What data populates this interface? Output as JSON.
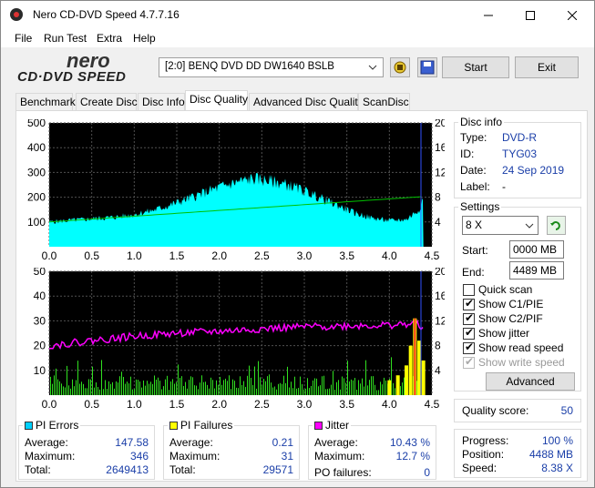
{
  "window": {
    "title": "Nero CD-DVD Speed 4.7.7.16"
  },
  "menu": [
    "File",
    "Run Test",
    "Extra",
    "Help"
  ],
  "logo": {
    "line1": "nero",
    "line2": "CD·DVD SPEED"
  },
  "toolbar": {
    "drive": "[2:0]   BENQ DVD DD DW1640 BSLB",
    "start_label": "Start",
    "exit_label": "Exit"
  },
  "tabs": [
    "Benchmark",
    "Create Disc",
    "Disc Info",
    "Disc Quality",
    "Advanced Disc Quality",
    "ScanDisc"
  ],
  "active_tab": "Disc Quality",
  "disc_info": {
    "heading": "Disc info",
    "type_label": "Type:",
    "type": "DVD-R",
    "id_label": "ID:",
    "id": "TYG03",
    "date_label": "Date:",
    "date": "24 Sep 2019",
    "label_label": "Label:",
    "label": "-"
  },
  "settings": {
    "heading": "Settings",
    "speed": "8 X",
    "start_label": "Start:",
    "start": "0000 MB",
    "end_label": "End:",
    "end": "4489 MB",
    "quick_scan": "Quick scan",
    "show_c1": "Show C1/PIE",
    "show_c2": "Show C2/PIF",
    "show_jitter": "Show jitter",
    "show_read": "Show read speed",
    "show_write": "Show write speed",
    "advanced": "Advanced"
  },
  "checks": {
    "quick_scan": false,
    "show_c1": true,
    "show_c2": true,
    "show_jitter": true,
    "show_read": true,
    "show_write": true
  },
  "quality": {
    "label": "Quality score:",
    "value": "50"
  },
  "progress": {
    "progress_label": "Progress:",
    "progress": "100 %",
    "position_label": "Position:",
    "position": "4488 MB",
    "speed_label": "Speed:",
    "speed": "8.38 X"
  },
  "pi_errors": {
    "heading": "PI Errors",
    "color": "#00d0ff",
    "avg_label": "Average:",
    "avg": "147.58",
    "max_label": "Maximum:",
    "max": "346",
    "total_label": "Total:",
    "total": "2649413"
  },
  "pi_failures": {
    "heading": "PI Failures",
    "color": "#ffff00",
    "avg_label": "Average:",
    "avg": "0.21",
    "max_label": "Maximum:",
    "max": "31",
    "total_label": "Total:",
    "total": "29571"
  },
  "jitter": {
    "heading": "Jitter",
    "color": "#ff00ff",
    "avg_label": "Average:",
    "avg": "10.43 %",
    "max_label": "Maximum:",
    "max": "12.7 %",
    "pof_label": "PO failures:",
    "pof": "0"
  },
  "chart_data": [
    {
      "type": "area",
      "left_ticks": [
        "500",
        "400",
        "300",
        "200",
        "100"
      ],
      "right_ticks": [
        "20",
        "16",
        "12",
        "8",
        "4"
      ],
      "x_ticks": [
        "0.0",
        "0.5",
        "1.0",
        "1.5",
        "2.0",
        "2.5",
        "3.0",
        "3.5",
        "4.0",
        "4.5"
      ],
      "xlim": [
        0,
        4.5
      ],
      "ylim": [
        0,
        500
      ],
      "y2lim": [
        0,
        20
      ],
      "series": [
        {
          "color": "#00ffff",
          "x": [
            0.0,
            0.2,
            0.4,
            0.6,
            0.8,
            1.0,
            1.2,
            1.4,
            1.6,
            1.8,
            2.0,
            2.2,
            2.4,
            2.6,
            2.8,
            3.0,
            3.2,
            3.4,
            3.6,
            3.8,
            4.0,
            4.2,
            4.35,
            4.4
          ],
          "y": [
            100,
            105,
            110,
            115,
            120,
            130,
            145,
            165,
            190,
            215,
            240,
            260,
            275,
            265,
            250,
            225,
            195,
            165,
            135,
            115,
            105,
            110,
            150,
            200
          ]
        },
        {
          "color": "#00c000",
          "axis": "right",
          "x": [
            0.0,
            4.4
          ],
          "y": [
            4,
            8.1
          ]
        }
      ]
    },
    {
      "type": "bar",
      "left_ticks": [
        "50",
        "40",
        "30",
        "20",
        "10"
      ],
      "right_ticks": [
        "20",
        "16",
        "12",
        "8",
        "4"
      ],
      "x_ticks": [
        "0.0",
        "0.5",
        "1.0",
        "1.5",
        "2.0",
        "2.5",
        "3.0",
        "3.5",
        "4.0",
        "4.5"
      ],
      "xlim": [
        0,
        4.5
      ],
      "ylim": [
        0,
        50
      ],
      "y2lim": [
        0,
        20
      ],
      "series": [
        {
          "color": "#ff00ff",
          "axis": "right",
          "x": [
            0.0,
            0.5,
            1.0,
            1.5,
            2.0,
            2.5,
            3.0,
            3.5,
            4.0,
            4.3,
            4.4
          ],
          "y": [
            8,
            8.8,
            9.5,
            10,
            10.3,
            10.7,
            11,
            11.2,
            11.3,
            11.5,
            11
          ]
        },
        {
          "color": "#ffff00",
          "x": [
            4.0,
            4.1,
            4.2,
            4.25,
            4.3,
            4.35,
            4.4
          ],
          "y": [
            6,
            8,
            12,
            20,
            31,
            22,
            14
          ]
        }
      ]
    }
  ]
}
